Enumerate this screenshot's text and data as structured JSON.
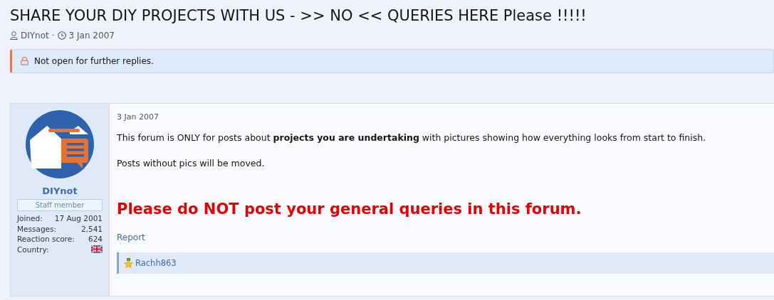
{
  "thread": {
    "title": "SHARE YOUR DIY PROJECTS WITH US - >> NO << QUERIES HERE Please !!!!!",
    "author": "DIYnot",
    "separator": "·",
    "date": "3 Jan 2007"
  },
  "notice": {
    "text": "Not open for further replies."
  },
  "post": {
    "user": {
      "name": "DIYnot",
      "role": "Staff member",
      "stats": [
        {
          "label": "Joined:",
          "value": "17 Aug 2001"
        },
        {
          "label": "Messages:",
          "value": "2,541"
        },
        {
          "label": "Reaction score:",
          "value": "624"
        },
        {
          "label": "Country:",
          "kind": "flag"
        }
      ]
    },
    "date": "3 Jan 2007",
    "paragraphs": [
      "This forum is ONLY for posts about **projects you are undertaking** with pictures showing how everything looks from start to finish.",
      "Posts without pics will be moved."
    ],
    "warning": "Please do NOT post your general queries in this forum.",
    "actions": [
      "Report"
    ],
    "reactions": [
      "Rachh863"
    ]
  }
}
